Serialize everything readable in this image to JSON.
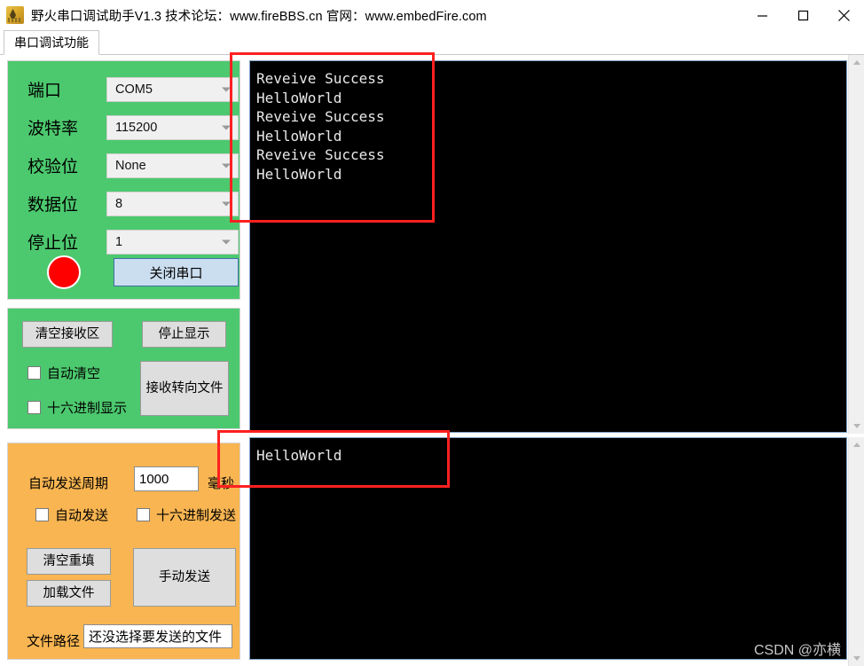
{
  "window": {
    "title": "野火串口调试助手V1.3     技术论坛：www.fireBBS.cn  官网：www.embedFire.com",
    "app_icon": "fire-flame-icon",
    "minimize_label": "minimize-icon",
    "maximize_label": "maximize-icon",
    "close_label": "close-icon"
  },
  "tabs": [
    {
      "label": "串口调试功能",
      "active": true
    }
  ],
  "port_panel": {
    "bg_color": "#4CC96E",
    "rows": [
      {
        "label": "端口",
        "value": "COM5"
      },
      {
        "label": "波特率",
        "value": "115200"
      },
      {
        "label": "校验位",
        "value": "None"
      },
      {
        "label": "数据位",
        "value": "8"
      },
      {
        "label": "停止位",
        "value": "1"
      }
    ],
    "led": {
      "name": "connection-status-led",
      "color": "#FE0000"
    },
    "close_button": {
      "label": "关闭串口",
      "color": "#CBDEF0"
    }
  },
  "recv_panel": {
    "bg_color": "#4CC96E",
    "clear_button": "清空接收区",
    "stop_button": "停止显示",
    "redirect_button": "接收转向文件",
    "checkboxes": [
      {
        "label": "自动清空",
        "checked": false
      },
      {
        "label": "十六进制显示",
        "checked": false
      }
    ]
  },
  "send_panel": {
    "bg_color": "#F8B551",
    "period_label": "自动发送周期",
    "period_value": "1000",
    "period_unit": "毫秒",
    "checkboxes": [
      {
        "label": "自动发送",
        "checked": false
      },
      {
        "label": "十六进制发送",
        "checked": false
      }
    ],
    "clear_refill_button": "清空重填",
    "load_file_button": "加载文件",
    "manual_send_button": "手动发送",
    "file_path_label": "文件路径",
    "file_path_value": "还没选择要发送的文件"
  },
  "receive_area": {
    "text": "Reveive Success\nHelloWorld\nReveive Success\nHelloWorld\nReveive Success\nHelloWorld"
  },
  "send_area": {
    "text": "HelloWorld"
  },
  "annotations": {
    "accent_color": "#FF2020",
    "receive_highlight": "receive-text-highlight",
    "send_highlight": "send-text-highlight"
  },
  "watermark": "CSDN @亦横"
}
